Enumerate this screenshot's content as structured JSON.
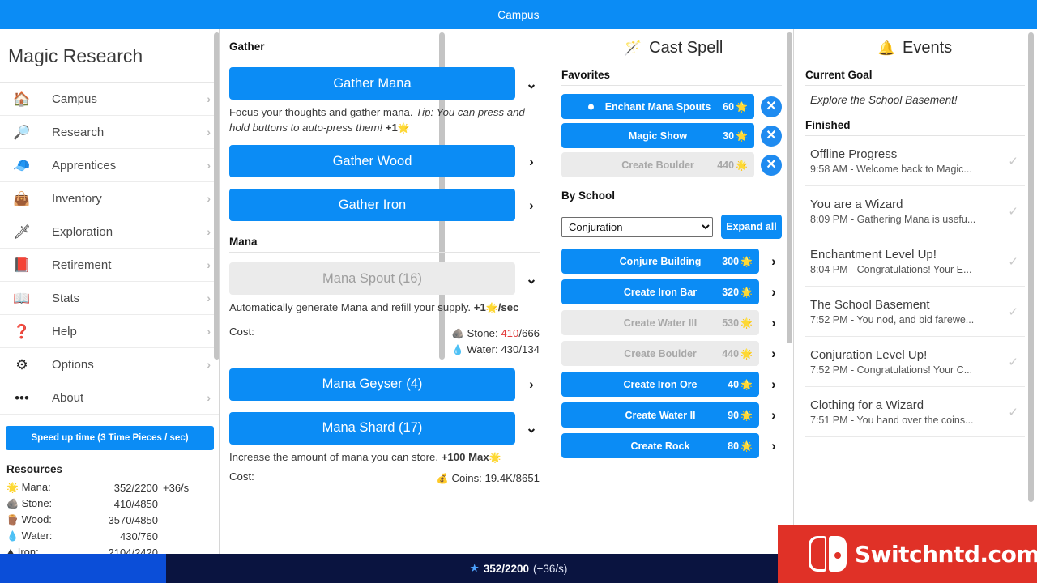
{
  "window": {
    "title": "Campus"
  },
  "sidebar": {
    "app_title": "Magic Research",
    "items": [
      {
        "label": "Campus",
        "icon": "house-icon",
        "glyph": "🏠"
      },
      {
        "label": "Research",
        "icon": "magnifier-icon",
        "glyph": "🔎"
      },
      {
        "label": "Apprentices",
        "icon": "wizard-hat-icon",
        "glyph": "🧢"
      },
      {
        "label": "Inventory",
        "icon": "sack-icon",
        "glyph": "👜"
      },
      {
        "label": "Exploration",
        "icon": "sword-icon",
        "glyph": "🗡"
      },
      {
        "label": "Retirement",
        "icon": "book-icon",
        "glyph": "📕"
      },
      {
        "label": "Stats",
        "icon": "chart-book-icon",
        "glyph": "📖"
      },
      {
        "label": "Help",
        "icon": "question-icon",
        "glyph": "❓"
      },
      {
        "label": "Options",
        "icon": "gear-icon",
        "glyph": "⚙"
      },
      {
        "label": "About",
        "icon": "dots-icon",
        "glyph": "•••"
      }
    ],
    "chevron": "›",
    "speedup_label": "Speed up time (3 Time Pieces / sec)",
    "resources_heading": "Resources",
    "resources": [
      {
        "icon": "mana-star-icon",
        "glyph": "🌟",
        "name": "Mana:",
        "value": "352/2200",
        "rate": "+36/s"
      },
      {
        "icon": "stone-icon",
        "glyph": "🪨",
        "name": "Stone:",
        "value": "410/4850",
        "rate": ""
      },
      {
        "icon": "wood-icon",
        "glyph": "🪵",
        "name": "Wood:",
        "value": "3570/4850",
        "rate": ""
      },
      {
        "icon": "water-drop-icon",
        "glyph": "💧",
        "name": "Water:",
        "value": "430/760",
        "rate": ""
      },
      {
        "icon": "iron-icon",
        "glyph": "⛰",
        "name": "Iron:",
        "value": "2104/2420",
        "rate": ""
      }
    ]
  },
  "gather": {
    "section_title": "Gather",
    "buttons": [
      {
        "label": "Gather Mana",
        "chevron": "⌄",
        "disabled": false
      },
      {
        "label": "Gather Wood",
        "chevron": "›",
        "disabled": false
      },
      {
        "label": "Gather Iron",
        "chevron": "›",
        "disabled": false
      }
    ],
    "mana_desc_plain": "Focus your thoughts and gather mana. ",
    "mana_desc_tip": "Tip: You can press and hold buttons to auto-press them!",
    "mana_desc_gain": " +1",
    "mana_desc_gain_icon": "🌟"
  },
  "mana": {
    "section_title": "Mana",
    "spout": {
      "label": "Mana Spout (16)",
      "chevron": "⌄",
      "disabled": true,
      "desc": "Automatically generate Mana and refill your supply. ",
      "desc_gain": "+1",
      "desc_gain_icon": "🌟",
      "desc_rate": "/sec",
      "cost_label": "Cost:",
      "costs": [
        {
          "icon": "stone-icon",
          "glyph": "🪨",
          "name": "Stone:",
          "have": "410",
          "need": "/666",
          "insufficient": true
        },
        {
          "icon": "water-drop-icon",
          "glyph": "💧",
          "name": "Water:",
          "have": "430",
          "need": "/134",
          "insufficient": false
        }
      ]
    },
    "geyser": {
      "label": "Mana Geyser (4)",
      "chevron": "›",
      "disabled": false
    },
    "shard": {
      "label": "Mana Shard (17)",
      "chevron": "⌄",
      "disabled": false,
      "desc": "Increase the amount of mana you can store. ",
      "desc_gain": "+100 Max",
      "desc_gain_icon": "🌟",
      "cost_label": "Cost:",
      "costs": [
        {
          "icon": "coins-icon",
          "glyph": "💰",
          "name": "Coins:",
          "have": "19.4K",
          "need": "/8651",
          "insufficient": false
        }
      ]
    }
  },
  "cast_spell": {
    "title": "Cast Spell",
    "title_icon": "magic-wand-icon",
    "title_glyph": "🪄",
    "favorites_heading": "Favorites",
    "favorites": [
      {
        "name": "Enchant Mana Spouts",
        "cost": "60",
        "cost_icon": "🌟",
        "disabled": false,
        "active": true
      },
      {
        "name": "Magic Show",
        "cost": "30",
        "cost_icon": "🌟",
        "disabled": false,
        "active": false
      },
      {
        "name": "Create Boulder",
        "cost": "440",
        "cost_icon": "🌟",
        "disabled": true,
        "active": false
      }
    ],
    "remove_glyph": "✕",
    "by_school_heading": "By School",
    "school_selected": "Conjuration",
    "school_options": [
      "Conjuration"
    ],
    "expand_all_label": "Expand all",
    "spells": [
      {
        "name": "Conjure Building",
        "cost": "300",
        "cost_icon": "🌟",
        "disabled": false,
        "chevron": "›"
      },
      {
        "name": "Create Iron Bar",
        "cost": "320",
        "cost_icon": "🌟",
        "disabled": false,
        "chevron": "›"
      },
      {
        "name": "Create Water III",
        "cost": "530",
        "cost_icon": "🌟",
        "disabled": true,
        "chevron": "›"
      },
      {
        "name": "Create Boulder",
        "cost": "440",
        "cost_icon": "🌟",
        "disabled": true,
        "chevron": "›"
      },
      {
        "name": "Create Iron Ore",
        "cost": "40",
        "cost_icon": "🌟",
        "disabled": false,
        "chevron": "›"
      },
      {
        "name": "Create Water II",
        "cost": "90",
        "cost_icon": "🌟",
        "disabled": false,
        "chevron": "›"
      },
      {
        "name": "Create Rock",
        "cost": "80",
        "cost_icon": "🌟",
        "disabled": false,
        "chevron": "›"
      }
    ]
  },
  "events": {
    "title": "Events",
    "title_icon": "bell-icon",
    "title_glyph": "🔔",
    "current_goal_heading": "Current Goal",
    "current_goal": "Explore the School Basement!",
    "finished_heading": "Finished",
    "check_glyph": "✓",
    "items": [
      {
        "title": "Offline Progress",
        "sub": "9:58 AM - Welcome back to Magic..."
      },
      {
        "title": "You are a Wizard",
        "sub": "8:09 PM - Gathering Mana is usefu..."
      },
      {
        "title": "Enchantment Level Up!",
        "sub": "8:04 PM - Congratulations! Your E..."
      },
      {
        "title": "The School Basement",
        "sub": "7:52 PM - You nod, and bid farewe..."
      },
      {
        "title": "Conjuration Level Up!",
        "sub": "7:52 PM - Congratulations! Your C..."
      },
      {
        "title": "Clothing for a Wizard",
        "sub": "7:51 PM - You hand over the coins..."
      }
    ]
  },
  "bottom_bar": {
    "icon": "mana-star-icon",
    "glyph": "★",
    "value": "352/2200",
    "rate": "(+36/s)",
    "fill_percent": 16
  },
  "watermark": {
    "text": "Switchntd.com"
  },
  "colors": {
    "accent_blue": "#0b8cf5",
    "title_blue": "#0b8cf5",
    "disabled_gray": "#ebebeb",
    "insufficient_red": "#e33b3b",
    "progress_fill": "#0b4ed8",
    "progress_track": "#0a1440",
    "watermark_red": "#e03127"
  }
}
